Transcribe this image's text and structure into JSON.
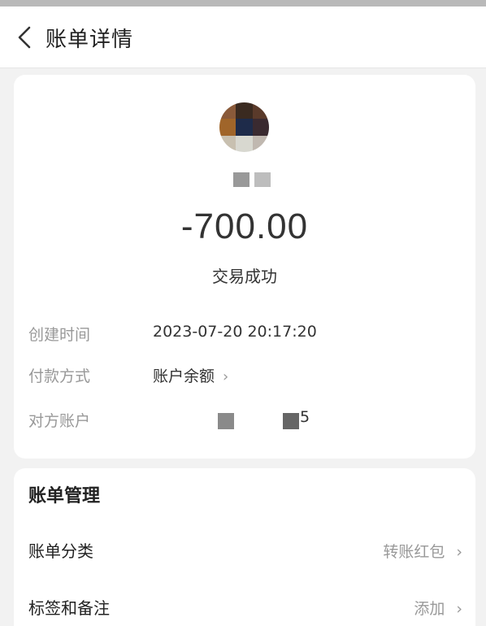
{
  "header": {
    "title": "账单详情",
    "back_icon": "chevron-left-icon"
  },
  "summary": {
    "amount": "-700.00",
    "status": "交易成功",
    "name_chevron": "›"
  },
  "details": [
    {
      "label": "创建时间",
      "value": "2023-07-20 20:17:20"
    },
    {
      "label": "付款方式",
      "value": "账户余额",
      "arrow": "›"
    },
    {
      "label": "对方账户",
      "value_tail": "5"
    }
  ],
  "management": {
    "title": "账单管理",
    "items": [
      {
        "label": "账单分类",
        "value": "转账红包",
        "arrow": "›"
      },
      {
        "label": "标签和备注",
        "value": "添加",
        "arrow": "›"
      }
    ]
  },
  "colors": {
    "background": "#f2f2f2",
    "card": "#ffffff",
    "label_gray": "#999999",
    "text_dark": "#333333"
  }
}
